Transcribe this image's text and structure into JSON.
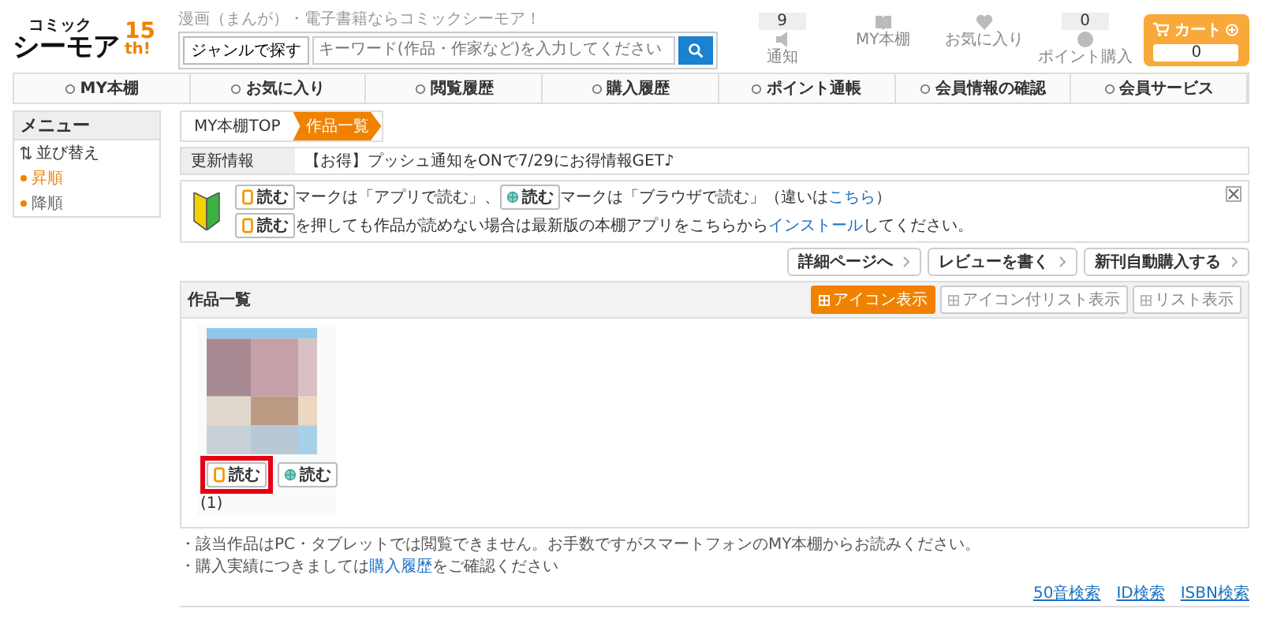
{
  "header": {
    "tagline": "漫画（まんが）・電子書籍ならコミックシーモア！",
    "logo_top": "コミック",
    "logo_main": "シーモア",
    "logo_badge": "15",
    "logo_badge_sub": "th!",
    "genre_button": "ジャンルで探す",
    "search": {
      "placeholder": "キーワード(作品・作家など)を入力してください"
    },
    "icons": [
      {
        "label": "通知",
        "count": "9"
      },
      {
        "label": "MY本棚"
      },
      {
        "label": "お気に入り"
      },
      {
        "label": "ポイント購入",
        "count": "0"
      }
    ],
    "cart": {
      "label": "カート",
      "count": "0"
    }
  },
  "nav": [
    "MY本棚",
    "お気に入り",
    "閲覧履歴",
    "購入履歴",
    "ポイント通帳",
    "会員情報の確認",
    "会員サービス"
  ],
  "sidebar": {
    "title": "メニュー",
    "section": "並び替え",
    "items": [
      {
        "label": "昇順",
        "selected": true
      },
      {
        "label": "降順",
        "selected": false
      }
    ]
  },
  "breadcrumb": [
    {
      "label": "MY本棚TOP",
      "selected": false
    },
    {
      "label": "作品一覧",
      "selected": true
    }
  ],
  "update": {
    "label": "更新情報",
    "text": "【お得】プッシュ通知をONで7/29にお得情報GET♪"
  },
  "notice": {
    "lines": [
      [
        {
          "kind": "app",
          "text": "読む"
        },
        {
          "kind": "text",
          "text": "マークは「アプリで読む」、"
        },
        {
          "kind": "browser",
          "text": "読む"
        },
        {
          "kind": "text",
          "text": "マークは「ブラウザで読む」（違いは"
        },
        {
          "kind": "link",
          "text": "こちら"
        },
        {
          "kind": "text",
          "text": "）"
        }
      ],
      [
        {
          "kind": "app",
          "text": "読む"
        },
        {
          "kind": "text",
          "text": "を押しても作品が読めない場合は最新版の本棚アプリをこちらから"
        },
        {
          "kind": "link",
          "text": "インストール"
        },
        {
          "kind": "text",
          "text": "してください。"
        }
      ]
    ]
  },
  "actions": [
    "詳細ページへ",
    "レビューを書く",
    "新刊自動購入する"
  ],
  "works": {
    "title": "作品一覧",
    "views": [
      {
        "label": "アイコン表示",
        "selected": true
      },
      {
        "label": "アイコン付リスト表示",
        "selected": false
      },
      {
        "label": "リスト表示",
        "selected": false
      }
    ],
    "items": [
      {
        "kind": "picture",
        "read_buttons": [
          {
            "kind": "app",
            "label": "読む",
            "highlighted": true
          },
          {
            "kind": "browser",
            "label": "読む",
            "highlighted": false
          }
        ],
        "count": "(1)"
      }
    ]
  },
  "notes": [
    [
      {
        "kind": "text",
        "text": "・該当作品はPC・タブレットでは閲覧できません。お手数ですがスマートフォンのMY本棚からお読みください。"
      }
    ],
    [
      {
        "kind": "text",
        "text": "・購入実績につきましては"
      },
      {
        "kind": "link",
        "text": "購入履歴"
      },
      {
        "kind": "text",
        "text": "をご確認ください"
      }
    ]
  ],
  "footer_links": [
    "50音検索",
    "ID検索",
    "ISBN検索"
  ]
}
